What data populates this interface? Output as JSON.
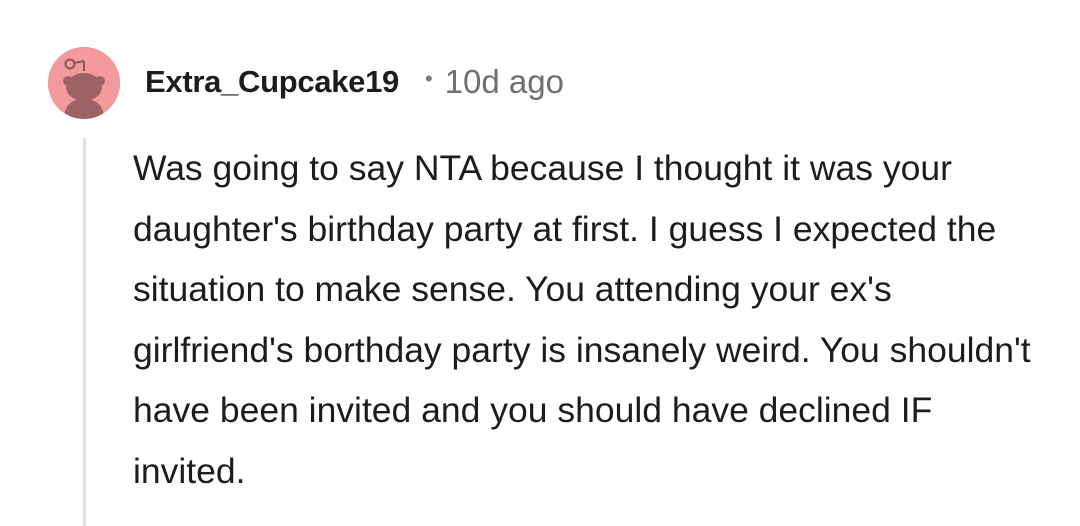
{
  "comment": {
    "username": "Extra_Cupcake19",
    "separator": "•",
    "timestamp": "10d ago",
    "body": "Was going to say NTA because I thought it was your daughter's birthday party at first. I guess I expected the situation to make sense. You attending your ex's girlfriend's borthday party is insanely weird. You shouldn't have been invited and you should have declined IF invited.",
    "avatar": {
      "icon": "reddit-snoo-avatar-icon",
      "background_color": "#f29a9c"
    }
  }
}
